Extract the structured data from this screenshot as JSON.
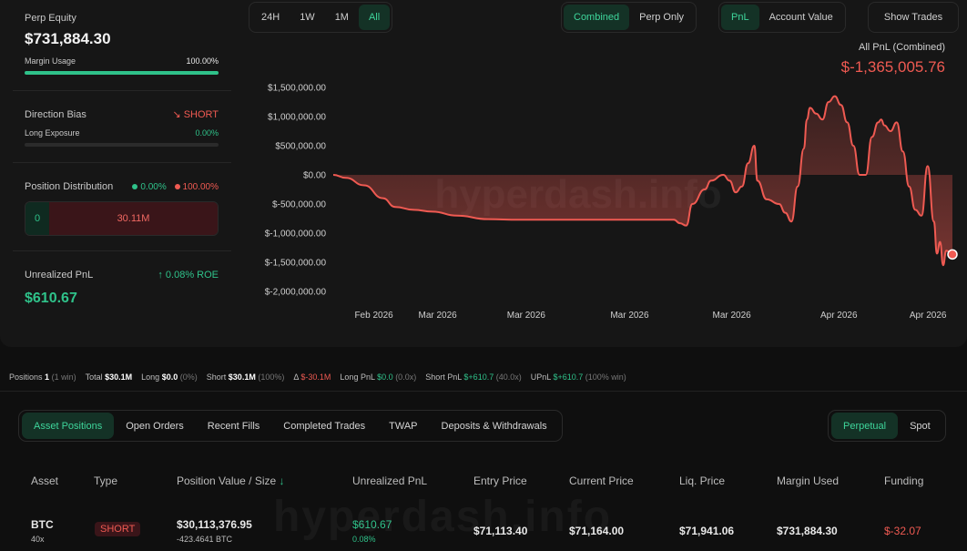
{
  "summary": {
    "perp_equity_label": "Perp Equity",
    "perp_equity_value": "$731,884.30",
    "margin_usage_label": "Margin Usage",
    "margin_usage_value": "100.00%",
    "margin_usage_fraction": 1.0,
    "direction_bias_label": "Direction Bias",
    "direction_bias_value": "SHORT",
    "long_exposure_label": "Long Exposure",
    "long_exposure_value": "0.00%",
    "long_exposure_fraction": 0.0,
    "position_distribution_label": "Position Distribution",
    "dist_long_pct": "0.00%",
    "dist_short_pct": "100.00%",
    "dist_long_value": "0",
    "dist_short_value": "30.11M",
    "unrealized_pnl_label": "Unrealized PnL",
    "unrealized_pnl_roe": "0.08% ROE",
    "unrealized_pnl_value": "$610.67"
  },
  "toolbar": {
    "ranges": [
      "24H",
      "1W",
      "1M",
      "All"
    ],
    "active_range": "All",
    "modes": [
      "Combined",
      "Perp Only"
    ],
    "active_mode": "Combined",
    "metrics": [
      "PnL",
      "Account Value"
    ],
    "active_metric": "PnL",
    "show_trades_label": "Show Trades"
  },
  "chart_header": {
    "label": "All PnL (Combined)",
    "value": "$-1,365,005.76"
  },
  "watermark": "hyperdash.info",
  "chart_data": {
    "type": "area",
    "ylim": [
      -2000000,
      1500000
    ],
    "y_ticks": [
      1500000,
      1000000,
      500000,
      0,
      -500000,
      -1000000,
      -1500000,
      -2000000
    ],
    "y_tick_labels": [
      "$1,500,000.00",
      "$1,000,000.00",
      "$500,000.00",
      "$0.00",
      "$-500,000.00",
      "$-1,000,000.00",
      "$-1,500,000.00",
      "$-2,000,000.00"
    ],
    "x_tick_labels": [
      "Feb 2026",
      "Mar 2026",
      "Mar 2026",
      "Mar 2026",
      "Mar 2026",
      "Apr 2026",
      "Apr 2026"
    ],
    "x_tick_positions": [
      0.095,
      0.198,
      0.341,
      0.508,
      0.673,
      0.846,
      0.99
    ],
    "x": [
      0.0,
      0.02,
      0.05,
      0.08,
      0.1,
      0.13,
      0.16,
      0.2,
      0.25,
      0.3,
      0.35,
      0.4,
      0.45,
      0.5,
      0.55,
      0.56,
      0.57,
      0.58,
      0.6,
      0.61,
      0.63,
      0.64,
      0.65,
      0.66,
      0.67,
      0.68,
      0.685,
      0.7,
      0.72,
      0.73,
      0.74,
      0.75,
      0.76,
      0.765,
      0.77,
      0.78,
      0.79,
      0.8,
      0.81,
      0.82,
      0.83,
      0.84,
      0.85,
      0.86,
      0.87,
      0.88,
      0.885,
      0.89,
      0.9,
      0.91,
      0.92,
      0.93,
      0.94,
      0.95,
      0.96,
      0.97,
      0.975,
      0.98,
      0.985,
      0.99,
      1.0
    ],
    "values": [
      0,
      -50000,
      -180000,
      -400000,
      -550000,
      -600000,
      -630000,
      -700000,
      -760000,
      -770000,
      -770000,
      -770000,
      -770000,
      -770000,
      -770000,
      -830000,
      -870000,
      -500000,
      -250000,
      -100000,
      0,
      -100000,
      -300000,
      -200000,
      200000,
      500000,
      -100000,
      -420000,
      -500000,
      -650000,
      -800000,
      -200000,
      450000,
      950000,
      1150000,
      1050000,
      950000,
      1250000,
      1350000,
      1200000,
      900000,
      500000,
      0,
      0,
      650000,
      900000,
      950000,
      850000,
      750000,
      900000,
      400000,
      -200000,
      -600000,
      -700000,
      150000,
      -800000,
      -1350000,
      -1150000,
      -1550000,
      -1300000,
      -1365006
    ],
    "series": [
      {
        "name": "All PnL (Combined)"
      }
    ]
  },
  "stats": {
    "positions_label": "Positions",
    "positions_value": "1",
    "positions_note": "(1 win)",
    "total_label": "Total",
    "total_value": "$30.1M",
    "long_label": "Long",
    "long_value": "$0.0",
    "long_note": "(0%)",
    "short_label": "Short",
    "short_value": "$30.1M",
    "short_note": "(100%)",
    "delta_label": "Δ",
    "delta_value": "$-30.1M",
    "long_pnl_label": "Long PnL",
    "long_pnl_value": "$0.0",
    "long_pnl_note": "(0.0x)",
    "short_pnl_label": "Short PnL",
    "short_pnl_value": "$+610.7",
    "short_pnl_note": "(40.0x)",
    "upnl_label": "UPnL",
    "upnl_value": "$+610.7",
    "upnl_note": "(100% win)"
  },
  "tabs": [
    "Asset Positions",
    "Open Orders",
    "Recent Fills",
    "Completed Trades",
    "TWAP",
    "Deposits & Withdrawals"
  ],
  "active_tab": "Asset Positions",
  "market_tabs": [
    "Perpetual",
    "Spot"
  ],
  "active_market_tab": "Perpetual",
  "table": {
    "columns": [
      "Asset",
      "Type",
      "Position Value / Size",
      "Unrealized PnL",
      "Entry Price",
      "Current Price",
      "Liq. Price",
      "Margin Used",
      "Funding"
    ],
    "sort_arrow": "↓",
    "rows": [
      {
        "asset": "BTC",
        "leverage": "40x",
        "type": "SHORT",
        "position_value": "$30,113,376.95",
        "size": "-423.4641 BTC",
        "pnl": "$610.67",
        "pnl_pct": "0.08%",
        "entry_price": "$71,113.40",
        "current_price": "$71,164.00",
        "liq_price": "$71,941.06",
        "margin_used": "$731,884.30",
        "funding": "$-32.07"
      }
    ]
  },
  "colors": {
    "green": "#2fc28a",
    "red": "#ef5a52",
    "bg": "#0f0f0f",
    "panel": "#161616"
  }
}
